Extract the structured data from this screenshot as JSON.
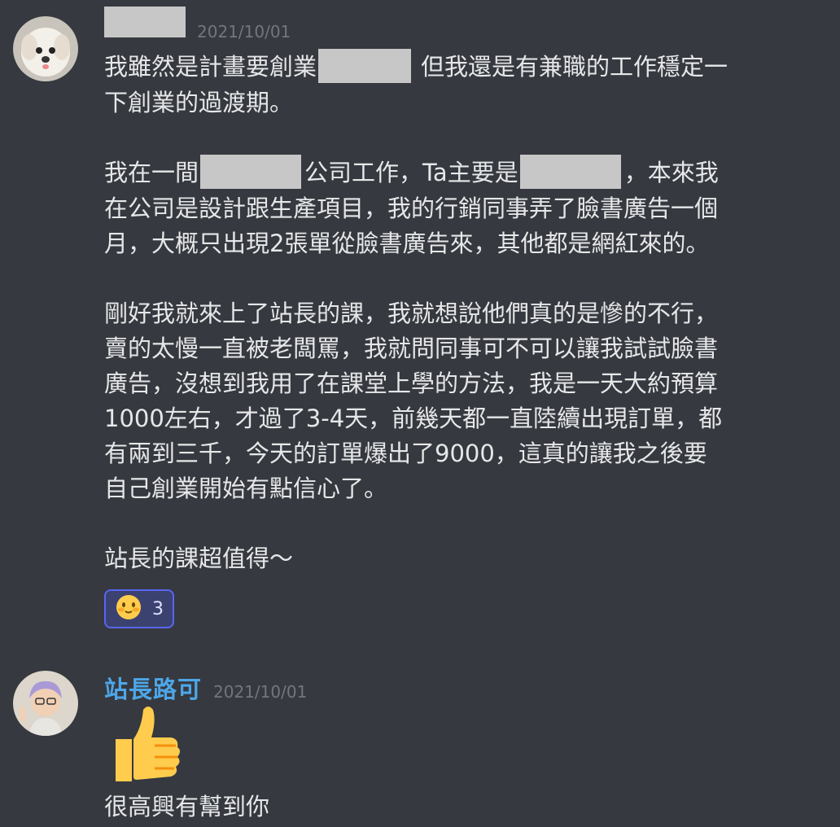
{
  "messages": [
    {
      "timestamp": "2021/10/01",
      "lines": [
        [
          "我雖然是計畫要創業",
          "但我還是有兼職的工作穩定一"
        ],
        [
          "下創業的過渡期。"
        ],
        [
          "我在一間",
          "公司工作，Ta主要是",
          "，本來我"
        ],
        [
          "在公司是設計跟生產項目，我的行銷同事弄了臉書廣告一個"
        ],
        [
          "月，大概只出現2張單從臉書廣告來，其他都是網紅來的。"
        ],
        [
          "剛好我就來上了站長的課，我就想說他們真的是慘的不行，"
        ],
        [
          "賣的太慢一直被老闆罵，我就問同事可不可以讓我試試臉書"
        ],
        [
          "廣告，沒想到我用了在課堂上學的方法，我是一天大約預算"
        ],
        [
          "1000左右，才過了3-4天，前幾天都一直陸續出現訂單，都"
        ],
        [
          "有兩到三千，今天的訂單爆出了9000，這真的讓我之後要"
        ],
        [
          "自己創業開始有點信心了。"
        ],
        [
          "站長的課超值得～"
        ]
      ],
      "reaction": {
        "icon": "blush-emoji",
        "count": "3"
      }
    },
    {
      "username": "站長路可",
      "timestamp": "2021/10/01",
      "emoji": "thumbs-up-emoji",
      "text": "很高興有幫到你"
    }
  ]
}
